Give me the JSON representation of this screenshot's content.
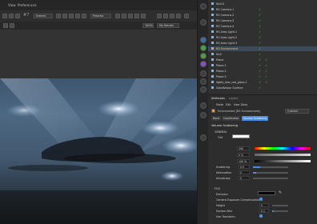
{
  "viewport": {
    "menu": [
      "View",
      "Preferences"
    ],
    "frame_label": "#7",
    "mode_dropdown": "Scenes",
    "camera_dropdown": "Preview",
    "zoom": "100%",
    "render_dropdown": "My Render"
  },
  "objects": {
    "items": [
      "Null.4",
      "RS Camera.1",
      "RS Camera.2",
      "RS Camera.3",
      "RS Camera.4",
      "RS Area Light.1",
      "RS Area Light.2",
      "RS Area Light.3",
      "RS Environment",
      "Null",
      "Plane",
      "Plane.1",
      "Plane.2",
      "Plane.3",
      "lights_rear_red_glass.1",
      "Subdivision Surface"
    ]
  },
  "attributes": {
    "header_tabs": [
      "Attributes",
      "Layers"
    ],
    "menu": [
      "Mode",
      "Edit",
      "User Data"
    ],
    "object_name": "Environment [RS Environment]",
    "scope_dropdown": "Custom",
    "tabs": [
      "Basic",
      "Coordinates",
      "Volume Scattering"
    ],
    "active_tab": "Volume Scattering",
    "section_title": "Volume Scattering",
    "general_label": "GENERAL",
    "tint_label": "Tint",
    "color_values": [
      "190",
      "0 %",
      "100 %"
    ],
    "scattering_label": "Scattering",
    "scattering_value": "0.0",
    "attenuation_label": "Attenuation",
    "attenuation_value": "0",
    "anisotropy_label": "Anisotropy",
    "anisotropy_value": "0",
    "fog_label": "FOG",
    "emission_label": "Emission",
    "camera_exposure_label": "Camera Exposure Compensation",
    "height_label": "Height",
    "horizon_blur_label": "Horizon Blur",
    "horizon_blur_value": "0.1",
    "use_transform_label": "Use Transform",
    "height_value": "0"
  }
}
